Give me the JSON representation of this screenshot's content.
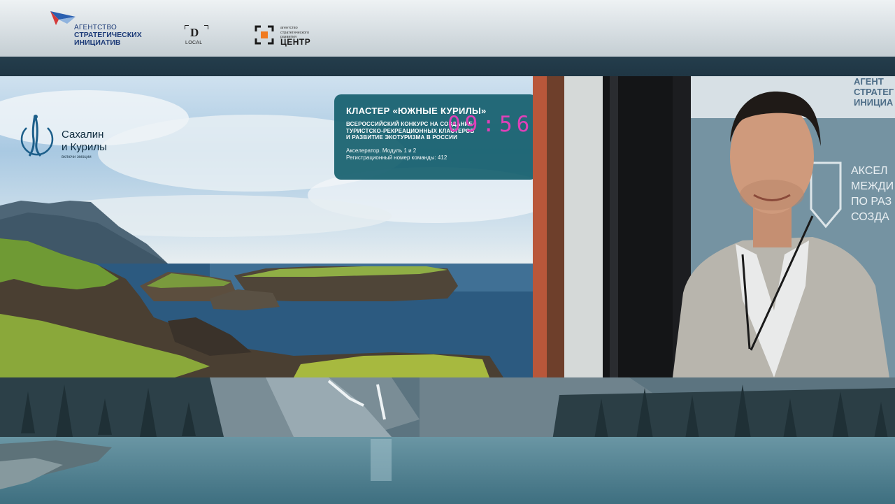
{
  "header": {
    "agency_logo": {
      "line1": "АГЕНТСТВО",
      "line2": "СТРАТЕГИЧЕСКИХ",
      "line3": "ИНИЦИАТИВ"
    },
    "local_logo": {
      "letter": "D",
      "text": "LOCAL"
    },
    "center_logo": {
      "small_line1": "агентство",
      "small_line2": "стратегического",
      "small_line3": "развития",
      "big": "ЦЕНТР"
    }
  },
  "slide": {
    "brand": {
      "title_line1": "Сахалин",
      "title_line2": "и Курилы",
      "tagline": "включи эмоции"
    },
    "infobox": {
      "title": "КЛАСТЕР «ЮЖНЫЕ КУРИЛЫ»",
      "subtitle_line1": "ВСЕРОССИЙСКИЙ КОНКУРС НА СОЗДАНИЕ",
      "subtitle_line2": "ТУРИСТСКО-РЕКРЕАЦИОННЫХ КЛАСТЕРОВ",
      "subtitle_line3": "И РАЗВИТИЕ ЭКОТУРИЗМА В РОССИИ",
      "meta_line1": "Акселератор. Модуль 1 и 2",
      "meta_line2": "Регистрационный номер команды: 412"
    },
    "timer": "09:56"
  },
  "video": {
    "wall_text_top": [
      "АГЕНТ",
      "СТРАТЕГ",
      "ИНИЦИА"
    ],
    "wall_text_main": [
      "АКСЕЛ",
      "МЕЖДИ",
      "ПО РАЗ",
      "СОЗДА"
    ]
  },
  "colors": {
    "header_bg": "#d7dee2",
    "band_bg": "#243d4c",
    "infobox_bg": "#16606e",
    "timer": "#e040b8",
    "agency_blue": "#1d3b78"
  }
}
